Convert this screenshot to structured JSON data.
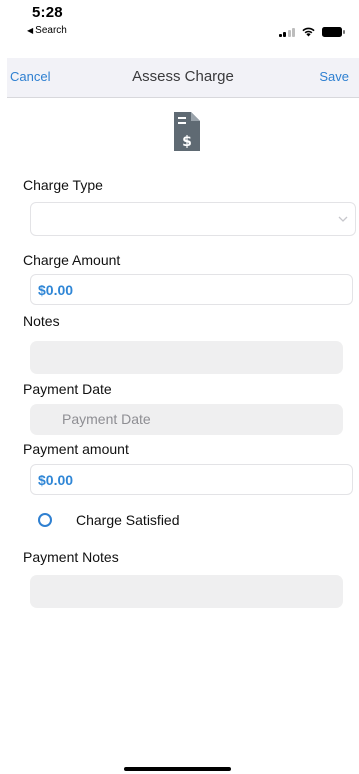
{
  "status_bar": {
    "time": "5:28",
    "back_label": "Search"
  },
  "nav": {
    "cancel_label": "Cancel",
    "title": "Assess Charge",
    "save_label": "Save"
  },
  "header_icon": "invoice-dollar-document",
  "form": {
    "charge_type": {
      "label": "Charge Type",
      "value": ""
    },
    "charge_amount": {
      "label": "Charge Amount",
      "value": "$0.00"
    },
    "notes": {
      "label": "Notes",
      "value": ""
    },
    "payment_date": {
      "label": "Payment Date",
      "placeholder": "Payment Date"
    },
    "payment_amount": {
      "label": "Payment amount",
      "value": "$0.00"
    },
    "charge_satisfied": {
      "label": "Charge Satisfied",
      "checked": false
    },
    "payment_notes": {
      "label": "Payment Notes",
      "value": ""
    }
  },
  "colors": {
    "accent": "#2f80d1",
    "amount_text": "#2f86d6",
    "nav_background": "#f2f2f7",
    "field_background": "#efeff0",
    "icon": "#5f6a73"
  }
}
